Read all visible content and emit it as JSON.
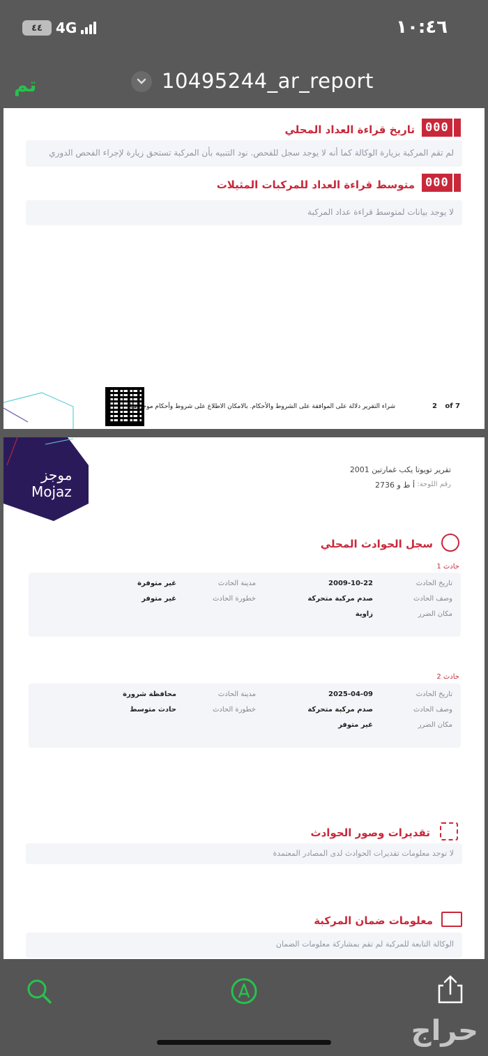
{
  "status": {
    "time": "١٠:٤٦",
    "battery": "٤٤",
    "network": "4G"
  },
  "nav": {
    "done_label": "تم",
    "title": "10495244_ar_report"
  },
  "page1": {
    "sections": [
      {
        "title": "تاريخ قراءة العداد المحلي",
        "odometer": "000",
        "text": "لم تقم المركبة بزيارة الوكالة كما أنه لا يوجد سجل للفحص. نود التنبيه بأن المركبة تستحق زيارة لإجراء الفحص الدوري"
      },
      {
        "title": "متوسط قراءة العداد للمركبات المثيلات",
        "odometer": "000",
        "text": "لا يوجد بيانات لمتوسط قراءة عداد المركبة"
      }
    ],
    "footer": {
      "terms": "شراء التقرير دلالة على الموافقة على الشروط والأحكام. بالامكان الاطلاع على شروط وأحكام موجز هنا:",
      "page_num": "2",
      "page_of": "of 7"
    }
  },
  "page2": {
    "logo": {
      "arabic": "موجز",
      "latin": "Mojaz"
    },
    "car_title": "تقرير تويوتا يكب غمارتين 2001",
    "plate_label": "رقم اللوحة:",
    "plate_value": "أ ط و 2736",
    "accidents_title": "سجل الحوادث المحلي",
    "accidents": [
      {
        "label": "حادث 1",
        "date_label": "تاريخ الحادث",
        "date": "2009-10-22",
        "city_label": "مدينة الحادث",
        "city": "غير متوفرة",
        "desc_label": "وصف الحادث",
        "desc": "صدم مركبة متحركة",
        "severity_label": "خطورة الحادث",
        "severity": "غير متوفر",
        "damage_label": "مكان الضرر",
        "damage": "زاوية"
      },
      {
        "label": "حادث 2",
        "date_label": "تاريخ الحادث",
        "date": "2025-04-09",
        "city_label": "مدينة الحادث",
        "city": "محافظة شرورة",
        "desc_label": "وصف الحادث",
        "desc": "صدم مركبة متحركة",
        "severity_label": "خطورة الحادث",
        "severity": "حادث متوسط",
        "damage_label": "مكان الضرر",
        "damage": "غير متوفر"
      }
    ],
    "estimates": {
      "title": "تقديرات وصور الحوادث",
      "text": "لا توجد معلومات تقديرات الحوادث لدى المصادر المعتمدة"
    },
    "warranty": {
      "title": "معلومات ضمان المركبة",
      "text": "الوكالة التابعة للمركبة لم تقم بمشاركة معلومات الضمان"
    }
  },
  "watermark": "حراج",
  "colors": {
    "accent_red": "#c8283a",
    "done_green": "#27c24c",
    "logo_purple": "#2b1a5a"
  },
  "icons": [
    "search-icon",
    "markup-icon",
    "share-icon",
    "chevron-down-icon"
  ]
}
